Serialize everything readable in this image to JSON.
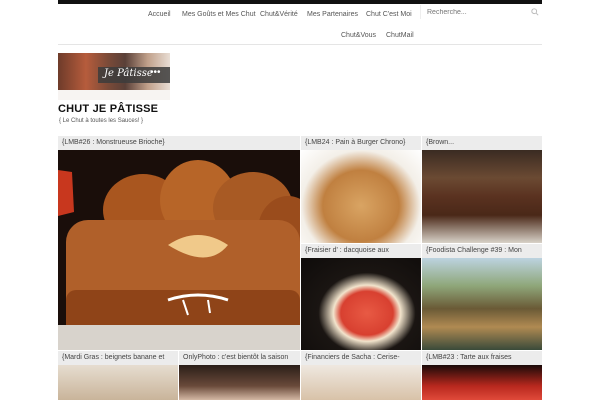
{
  "nav": {
    "items": [
      "Accueil",
      "Mes Goûts et Mes Chut",
      "Chut&Vérité",
      "Mes Partenaires",
      "Chut C'est Moi",
      "Chut&Vous",
      "ChutMail"
    ],
    "search_placeholder": "Recherche..."
  },
  "logo": {
    "text": "Je Pâtisse",
    "dots": "•••"
  },
  "site": {
    "title": "CHUT JE PÂTISSE",
    "tagline": "{ Le Chut à toutes les Sauces! }"
  },
  "posts": [
    "{LMB#26 : Monstrueuse Brioche}",
    "{LMB24 : Pain à Burger Chrono}",
    "{Brown...",
    "{Fraisier d'     : dacquoise aux",
    "{Foodista Challenge #39 : Mon",
    "{Mardi Gras : beignets banane et",
    "OnlyPhoto : c'est bientôt la saison",
    "{Financiers de Sacha : Cerise-",
    "{LMB#23 : Tarte aux fraises"
  ],
  "colors": {
    "topbar": "#111111",
    "label_bg": "#ebebeb"
  }
}
